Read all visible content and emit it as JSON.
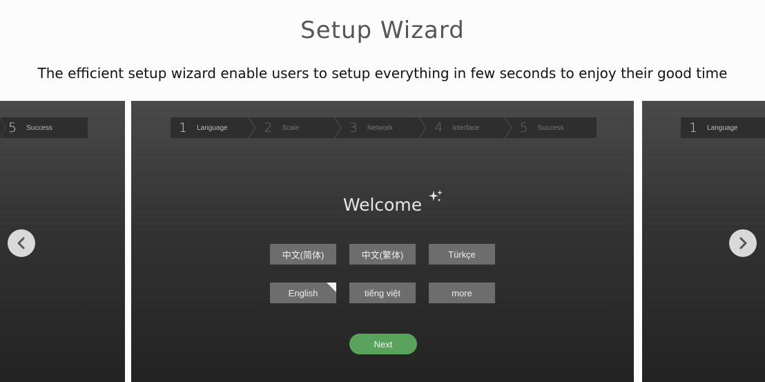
{
  "header": {
    "title": "Setup Wizard",
    "subtitle": "The efficient setup wizard enable users to setup everything in few seconds to enjoy their good time"
  },
  "wizard": {
    "steps": [
      {
        "num": "1",
        "label": "Language",
        "active": true
      },
      {
        "num": "2",
        "label": "Scale",
        "active": false
      },
      {
        "num": "3",
        "label": "Network",
        "active": false
      },
      {
        "num": "4",
        "label": "Interface",
        "active": false
      },
      {
        "num": "5",
        "label": "Success",
        "active": false
      }
    ],
    "welcome": "Welcome",
    "languages": [
      "中文(简体)",
      "中文(繁体)",
      "Türkçe",
      "English",
      "tiếng việt",
      "more"
    ],
    "selected_language": "English",
    "next_label": "Next"
  },
  "prev_slide": {
    "step_num": "5",
    "step_label": "Success"
  },
  "next_slide": {
    "step_num": "1",
    "step_label": "Language"
  },
  "colors": {
    "accent_green": "#5aa35c",
    "panel_dark": "#333333",
    "button_gray": "#6d6d6d"
  },
  "icons": {
    "prev": "chevron-left-icon",
    "next": "chevron-right-icon",
    "sparkle": "sparkle-icon",
    "selected": "corner-check-icon"
  }
}
